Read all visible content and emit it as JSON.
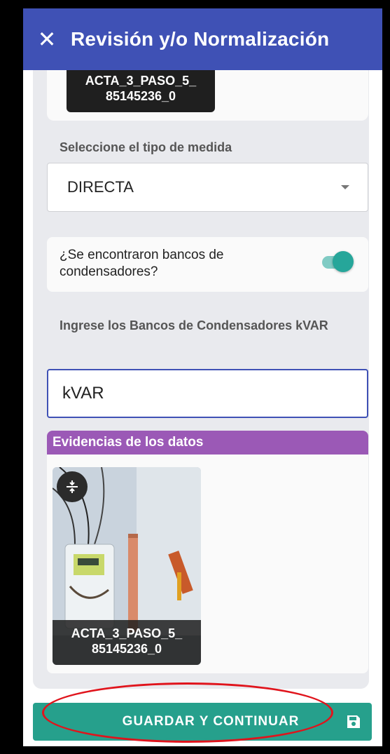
{
  "appbar": {
    "close_icon": "close-icon",
    "title": "Revisión y/o Normalización"
  },
  "top_photo": {
    "caption_line1": "ACTA_3_PASO_5_",
    "caption_line2": "85145236_0"
  },
  "measure": {
    "label": "Seleccione el tipo de medida",
    "selected": "DIRECTA",
    "caret_icon": "caret-down-icon"
  },
  "capacitor_question": {
    "text": "¿Se encontraron bancos de condensadores?",
    "enabled": true
  },
  "kvar": {
    "label": "Ingrese los Bancos de Condensadores kVAR",
    "value": "kVAR"
  },
  "evidence": {
    "header": "Evidencias de los datos",
    "photo_caption_line1": "ACTA_3_PASO_5_",
    "photo_caption_line2": "85145236_0",
    "compress_icon": "compress-icon"
  },
  "footer": {
    "save_label": "GUARDAR Y CONTINUAR",
    "save_icon": "floppy-disk-icon"
  },
  "colors": {
    "appbar": "#3f51b5",
    "toggle": "#26a69a",
    "evidence_header": "#9b59b6",
    "save_button": "#26a08c",
    "highlight": "#e0141c"
  }
}
